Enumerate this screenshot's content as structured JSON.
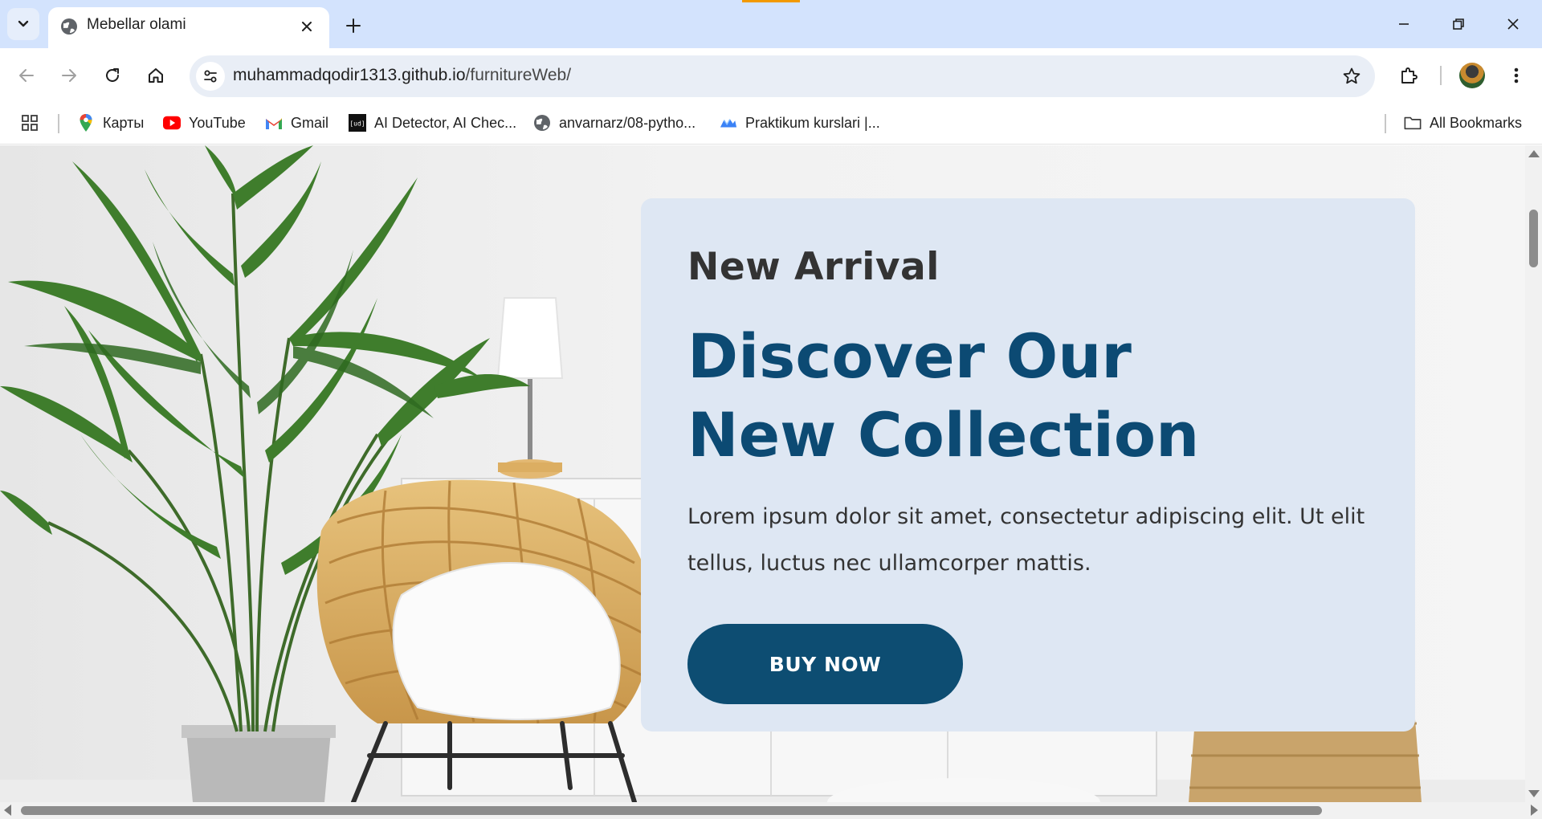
{
  "browser": {
    "tab": {
      "title": "Mebellar olami",
      "favicon": "globe-icon",
      "close_icon": "close-icon"
    },
    "new_tab_icon": "plus-icon",
    "tab_search_icon": "chevron-down-icon",
    "window_controls": [
      "minimize-icon",
      "restore-icon",
      "close-icon"
    ],
    "nav": {
      "back_icon": "arrow-left-icon",
      "forward_icon": "arrow-right-icon",
      "reload_icon": "reload-icon",
      "home_icon": "home-icon"
    },
    "omnibox": {
      "domain": "muhammadqodir1313.github.io",
      "path": "/furnitureWeb/",
      "site_info_icon": "tune-icon",
      "bookmark_icon": "star-icon"
    },
    "toolbar_icons": [
      "extensions-icon",
      "avatar",
      "more-vert-icon"
    ],
    "bookmarks": [
      {
        "label": "Карты",
        "icon": "maps-pin-icon"
      },
      {
        "label": "YouTube",
        "icon": "youtube-icon"
      },
      {
        "label": "Gmail",
        "icon": "gmail-icon"
      },
      {
        "label": "AI Detector, AI Chec...",
        "icon": "ud-icon"
      },
      {
        "label": "anvarnarz/08-pytho...",
        "icon": "globe-icon"
      },
      {
        "label": "Praktikum kurslari |...",
        "icon": "praktikum-icon"
      }
    ],
    "all_bookmarks": {
      "label": "All Bookmarks",
      "icon": "folder-icon"
    },
    "apps_icon": "apps-grid-icon"
  },
  "hero": {
    "eyebrow": "New Arrival",
    "headline_line1": "Discover Our",
    "headline_line2": "New Collection",
    "description": "Lorem ipsum dolor sit amet, consectetur adipiscing elit. Ut elit tellus, luctus nec ullamcorper mattis.",
    "button_label": "BUY NOW",
    "colors": {
      "card_bg": "#dee7f3",
      "headline": "#0c4a73",
      "button_bg": "#0d4d72",
      "text": "#333333"
    }
  },
  "colors": {
    "tabstrip_bg": "#d3e3fd",
    "omnibox_bg": "#e9eef6",
    "loading_accent": "#f29900"
  }
}
